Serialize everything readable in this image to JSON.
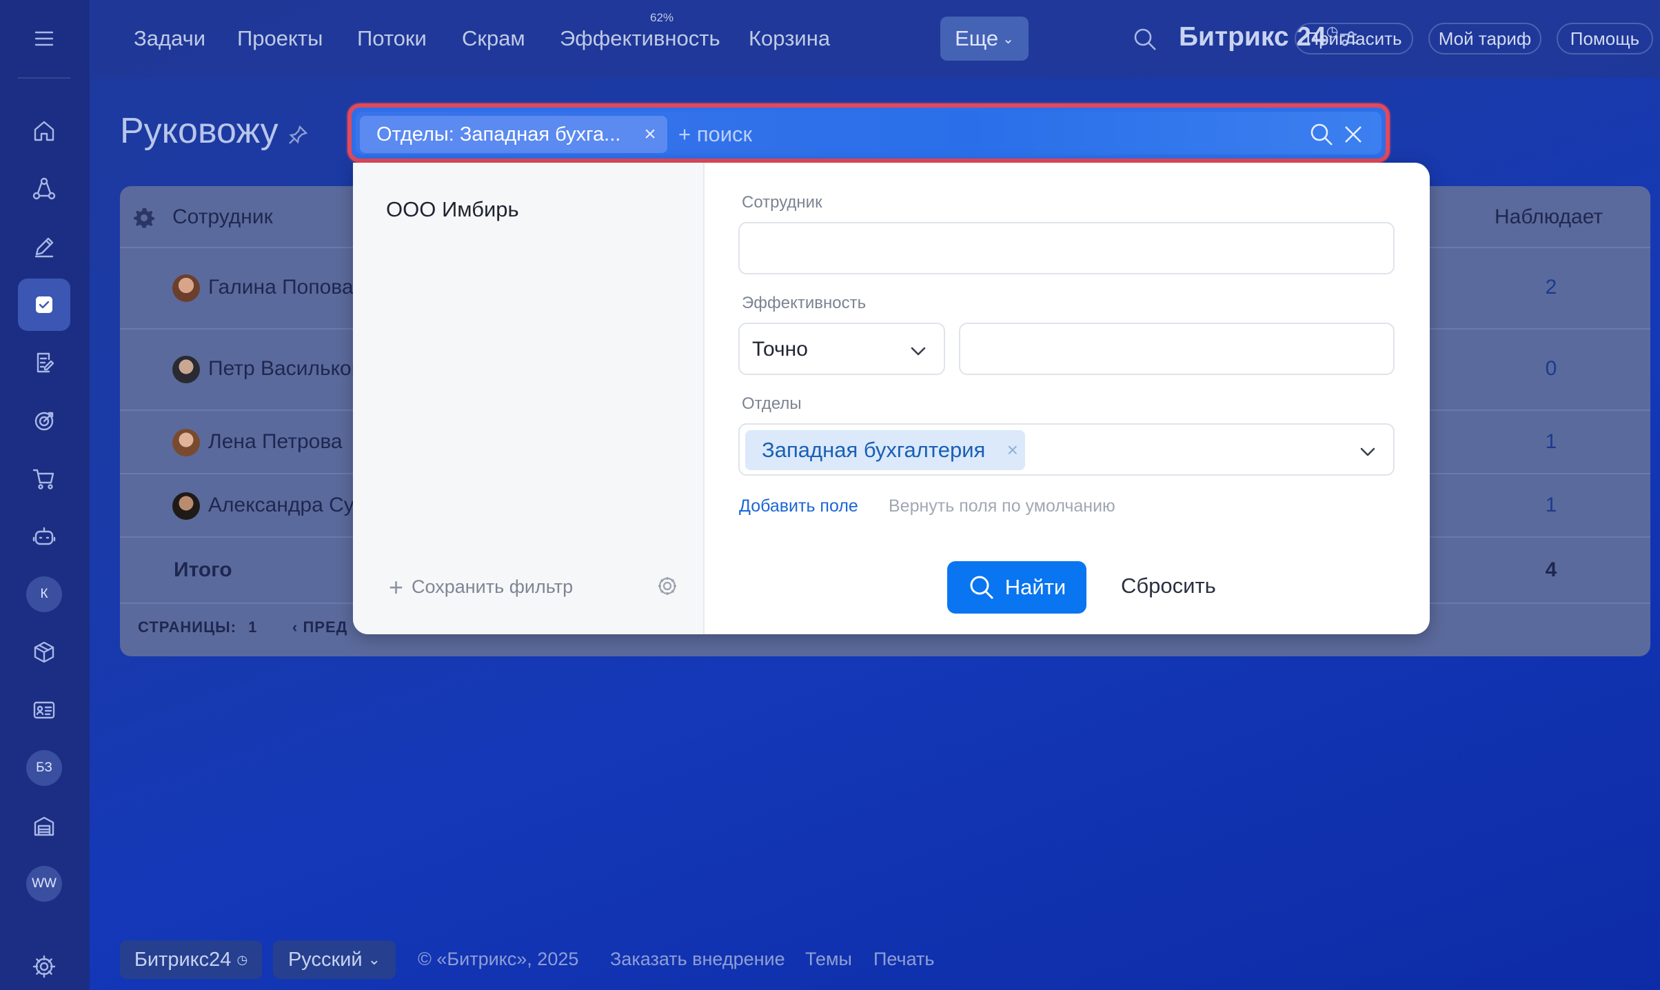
{
  "topnav": {
    "items": [
      "Задачи",
      "Проекты",
      "Потоки",
      "Скрам",
      "Эффективность",
      "Корзина"
    ],
    "efficiency_badge": "62%",
    "more_label": "Еще",
    "brand": "Битрикс 24",
    "invite_label": "Пригласить",
    "tariff_label": "Мой тариф",
    "help_label": "Помощь"
  },
  "sidebar": {
    "icons": [
      "menu-icon",
      "home-icon",
      "network-icon",
      "pen-icon",
      "tasks-icon",
      "document-icon",
      "target-icon",
      "cart-icon",
      "robot-icon",
      "user-k",
      "box-icon",
      "card-icon",
      "user-bz",
      "warehouse-icon",
      "user-ww",
      "settings-icon"
    ],
    "avatar_k": "К",
    "avatar_bz": "БЗ",
    "avatar_ww": "WW"
  },
  "page": {
    "title": "Руковожу"
  },
  "grid": {
    "headers": {
      "employee": "Сотрудник",
      "observes": "Наблюдает"
    },
    "rows": [
      {
        "name": "Галина Попова",
        "value": "2"
      },
      {
        "name": "Петр Васильков",
        "value": "0"
      },
      {
        "name": "Лена Петрова",
        "value": "1"
      },
      {
        "name": "Александра Су",
        "value": "1"
      }
    ],
    "total_label": "Итого",
    "total_value": "4",
    "pages_label": "СТРАНИЦЫ:",
    "pages_value": "1",
    "prev_label": "ПРЕД"
  },
  "filter": {
    "chip_label": "Отделы: Западная бухга...",
    "search_placeholder": "+ поиск",
    "presets": [
      "ООО Имбирь"
    ],
    "save_filter_label": "Сохранить фильтр",
    "fields": {
      "employee_label": "Сотрудник",
      "employee_value": "",
      "efficiency_label": "Эффективность",
      "efficiency_mode": "Точно",
      "efficiency_value": "",
      "departments_label": "Отделы",
      "departments_selected": "Западная бухгалтерия"
    },
    "add_field_label": "Добавить поле",
    "reset_fields_label": "Вернуть поля по умолчанию",
    "find_label": "Найти",
    "reset_label": "Сбросить"
  },
  "footer": {
    "brand": "Битрикс24",
    "language": "Русский",
    "copyright": "© «Битрикс», 2025",
    "links": [
      "Заказать внедрение",
      "Темы",
      "Печать"
    ]
  },
  "colors": {
    "accent": "#0a75f0",
    "highlight_border": "#e2495a",
    "sidebar_bg": "#1b2e83"
  }
}
